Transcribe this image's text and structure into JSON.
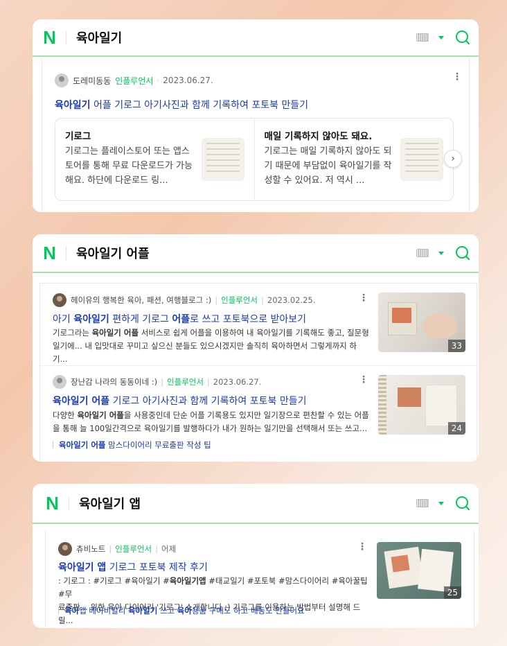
{
  "colors": {
    "naver_green": "#03c75a",
    "link_blue": "#1a3bb3",
    "influencer_green": "#03c75a"
  },
  "cards": [
    {
      "logo": "N",
      "query": "육아일기",
      "icons": [
        "keyboard-icon",
        "chevron-down-icon",
        "search-icon"
      ],
      "result": {
        "author": "도레미동동",
        "badge": "인플루언서",
        "date": "2023.06.27.",
        "title_bold": "육아일기",
        "title_rest": " 어플 기로그 아기사진과 함께 기록하여 포토북 만들기",
        "subs": [
          {
            "heading": "기로그",
            "text": "기로그는 플레이스토어 또는 앱스토어를 통해 무료 다운로드가 가능해요. 하단에 다운로드 링..."
          },
          {
            "heading": "매일 기록하지 않아도 돼요.",
            "text": "기로그는 매일 기록하지 않아도 되기 때문에 부담없이 육아일기를 작성할 수 있어요. 저 역시 ..."
          }
        ]
      }
    },
    {
      "logo": "N",
      "query": "육아일기 어플",
      "results": [
        {
          "author": "헤이유의 행복한 육아, 패션, 여행블로그 :)",
          "badge": "인플루언서",
          "date": "2023.02.25.",
          "title_parts": [
            "아기 ",
            "육아일기",
            " 편하게 기로그 ",
            "어플",
            "로 쓰고 포토북으로 받아보기"
          ],
          "desc_line1_parts": [
            "기로그라는 ",
            "육아일기 어플",
            " 서비스로 쉽게 어플을 이용하여 내 육아일기를 기록해도 좋고, 질문형"
          ],
          "desc_line2": "일기에... 내 입맛대로 꾸미고 싶으신 분들도 있으시겠지만 솔직히 육아하면서 그렇게까지 하기...",
          "thumb_count": "33"
        },
        {
          "author": "장난감 나라의 동동이네 :)",
          "badge": "인플루언서",
          "date": "2023.06.27.",
          "title_parts": [
            "육아일기 어플",
            " 기로그 아기사진과 함께 기록하여 포토북 만들기"
          ],
          "desc_line1_parts": [
            "다양한 ",
            "육아일기 어플",
            "을 사용중인데 단순 어플 기록용도 있지만 일기장으로 편찬할 수 있는 어플"
          ],
          "desc_line2": "을 통해 늘 100일간격으로 육아일기를 발행하다가 내가 원하는 일기만을 선택해서 또는 쓰고...",
          "tag_parts": [
            "육아일기 어플",
            " 맘스다이어리 무료출판 작성 팁"
          ],
          "thumb_count": "24"
        }
      ]
    },
    {
      "logo": "N",
      "query": "육아일기 앱",
      "result": {
        "author": "츄비노트",
        "badge": "인플루언서",
        "date": "어제",
        "title_parts": [
          "육아일기 앱",
          " 기로그 포토북 제작 후기"
        ],
        "desc_line1_parts": [
          ": 기로그 : #기로그 #육아일기 #",
          "육아일기앱",
          " #태교일기 #포토북 #맘스다이어리 #육아꿀팁 #무"
        ],
        "desc_line2": "료출판... 위한 육아 다이어리 '기로그' 소개합니다 :) 기로그를 이용하는 방법부터 설명해 드릴...",
        "tag_parts": [
          "육아",
          "앱 베이비빌리 ",
          "육아일기",
          " 쓰고 ",
          "육아",
          "용품 구매도 하고 베동도 만들어요"
        ],
        "thumb_count": "25"
      }
    }
  ]
}
